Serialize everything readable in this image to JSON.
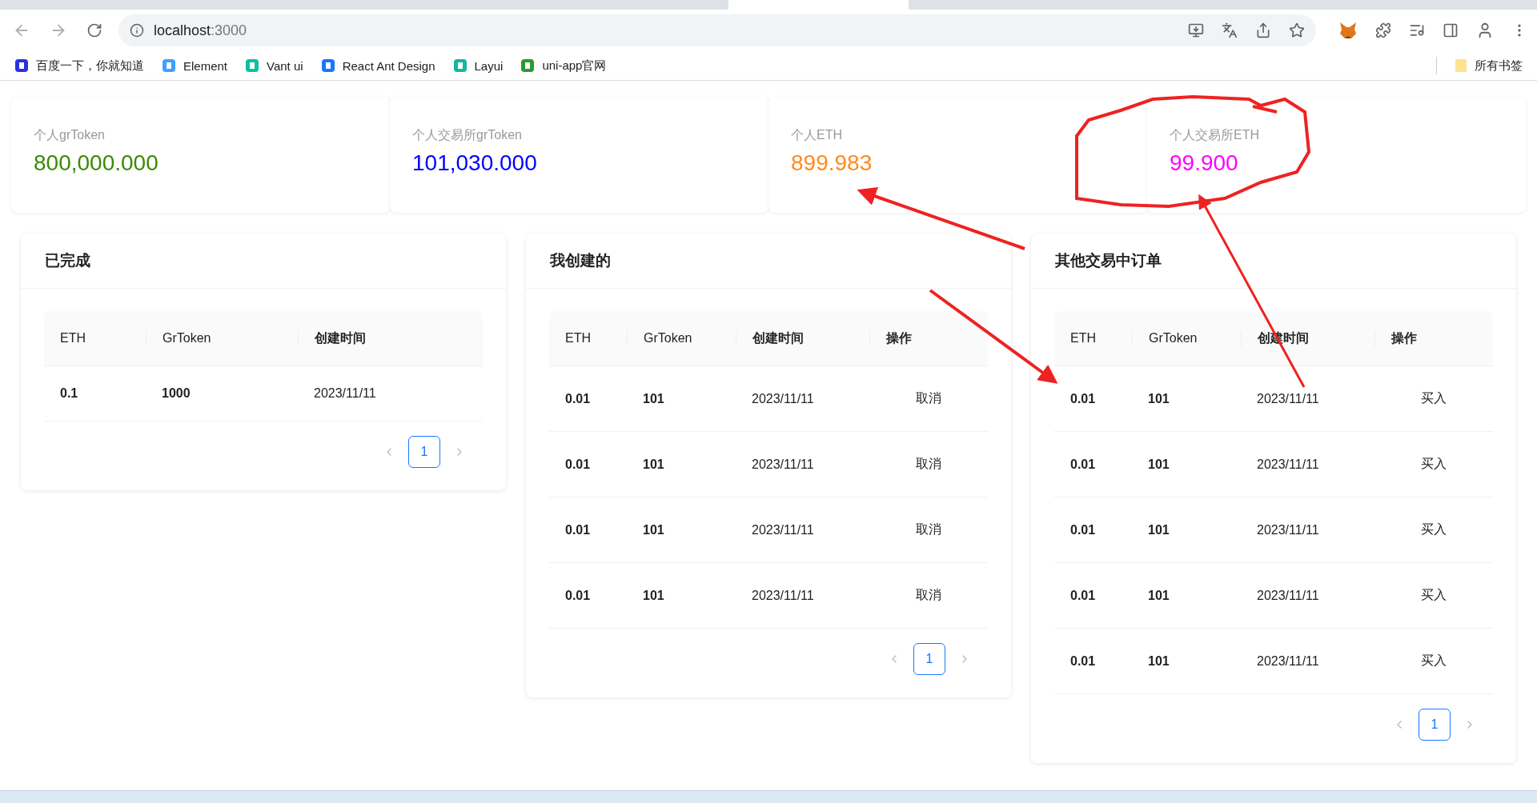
{
  "browser": {
    "url_host": "localhost",
    "url_port": ":3000",
    "bookmarks": [
      {
        "label": "百度一下，你就知道",
        "color": "#2932e1"
      },
      {
        "label": "Element",
        "color": "#409eff"
      },
      {
        "label": "Vant ui",
        "color": "#07c1a0"
      },
      {
        "label": "React Ant Design",
        "color": "#1677ff"
      },
      {
        "label": "Layui",
        "color": "#16b5a0"
      },
      {
        "label": "uni-app官网",
        "color": "#2b9939"
      }
    ],
    "all_bookmarks": "所有书签"
  },
  "stats": [
    {
      "label": "个人grToken",
      "value": "800,000.000",
      "color": "#3b8a00"
    },
    {
      "label": "个人交易所grToken",
      "value": "101,030.000",
      "color": "#0000ff"
    },
    {
      "label": "个人ETH",
      "value": "899.983",
      "color": "#ff8a1c"
    },
    {
      "label": "个人交易所ETH",
      "value": "99.900",
      "color": "#ff00ff"
    }
  ],
  "panels": [
    {
      "title": "已完成",
      "columns": [
        "ETH",
        "GrToken",
        "创建时间"
      ],
      "rows": [
        [
          "0.1",
          "1000",
          "2023/11/11"
        ]
      ],
      "page": "1"
    },
    {
      "title": "我创建的",
      "columns": [
        "ETH",
        "GrToken",
        "创建时间",
        "操作"
      ],
      "rows": [
        [
          "0.01",
          "101",
          "2023/11/11",
          "取消"
        ],
        [
          "0.01",
          "101",
          "2023/11/11",
          "取消"
        ],
        [
          "0.01",
          "101",
          "2023/11/11",
          "取消"
        ],
        [
          "0.01",
          "101",
          "2023/11/11",
          "取消"
        ]
      ],
      "page": "1"
    },
    {
      "title": "其他交易中订单",
      "columns": [
        "ETH",
        "GrToken",
        "创建时间",
        "操作"
      ],
      "rows": [
        [
          "0.01",
          "101",
          "2023/11/11",
          "买入"
        ],
        [
          "0.01",
          "101",
          "2023/11/11",
          "买入"
        ],
        [
          "0.01",
          "101",
          "2023/11/11",
          "买入"
        ],
        [
          "0.01",
          "101",
          "2023/11/11",
          "买入"
        ],
        [
          "0.01",
          "101",
          "2023/11/11",
          "买入"
        ]
      ],
      "page": "1"
    }
  ]
}
